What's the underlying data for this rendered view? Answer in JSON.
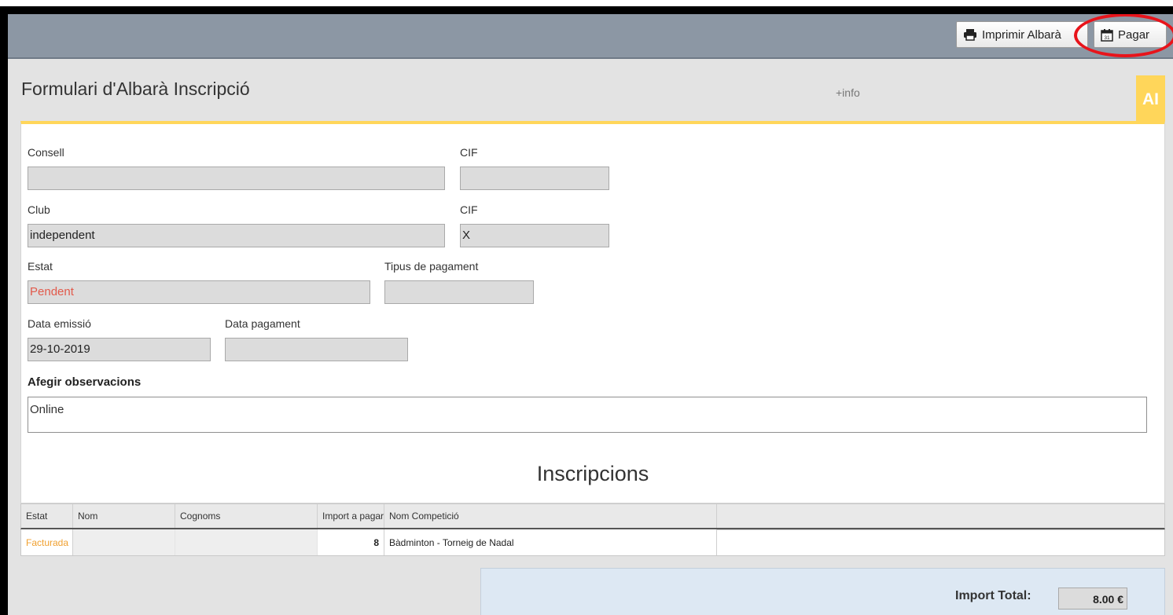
{
  "toolbar": {
    "print_label": "Imprimir Albarà",
    "pay_label": "Pagar"
  },
  "header": {
    "title": "Formulari d'Albarà Inscripció",
    "info_link": "+info",
    "badge": "AI"
  },
  "form": {
    "consell": {
      "label": "Consell",
      "value": ""
    },
    "cif1": {
      "label": "CIF",
      "value": ""
    },
    "club": {
      "label": "Club",
      "value": "independent"
    },
    "cif2": {
      "label": "CIF",
      "value": "X"
    },
    "estat": {
      "label": "Estat",
      "value": "Pendent",
      "color": "#e25a4b"
    },
    "tipus_pagament": {
      "label": "Tipus de pagament",
      "value": ""
    },
    "data_emissio": {
      "label": "Data emissió",
      "value": "29-10-2019"
    },
    "data_pagament": {
      "label": "Data pagament",
      "value": ""
    },
    "observacions": {
      "label": "Afegir observacions",
      "value": "Online"
    }
  },
  "inscripcions": {
    "title": "Inscripcions",
    "columns": [
      "Estat",
      "Nom",
      "Cognoms",
      "Import a pagar",
      "Nom Competició",
      ""
    ],
    "rows": [
      {
        "estat": "Facturada",
        "nom": "",
        "cognoms": "",
        "import": "8",
        "competicio": "Bàdminton - Torneig de Nadal"
      }
    ]
  },
  "total": {
    "label": "Import Total:",
    "value": "8.00 €"
  },
  "colors": {
    "toolbar_bg": "#8c97a4",
    "accent_yellow": "#ffd65a",
    "status_pending": "#e25a4b",
    "status_invoiced": "#f0a030",
    "highlight_ring": "#e8141b"
  }
}
